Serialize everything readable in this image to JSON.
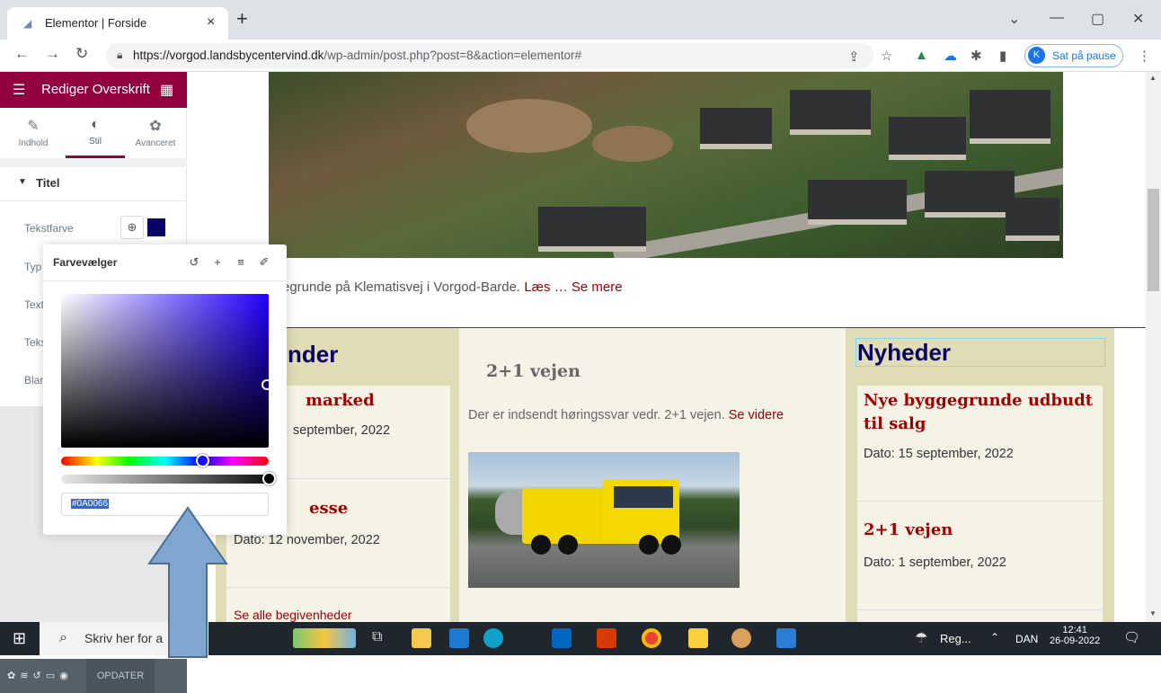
{
  "browser": {
    "tab_title": "Elementor | Forside",
    "tab_close": "×",
    "new_tab": "+",
    "url_host": "https://vorgod.landsbycentervind.dk",
    "url_path": "/wp-admin/post.php?post=8&action=elementor#",
    "profile_initial": "K",
    "profile_label": "Sat på pause",
    "window_controls": [
      "⌄",
      "—",
      "▢",
      "✕"
    ]
  },
  "panel": {
    "header_title": "Rediger Overskrift",
    "tabs": [
      {
        "label": "Indhold",
        "icon": "pencil-icon"
      },
      {
        "label": "Stil",
        "icon": "contrast-icon"
      },
      {
        "label": "Avanceret",
        "icon": "gear-icon"
      }
    ],
    "section_title": "Titel",
    "controls": [
      "Tekstfarve",
      "Typ",
      "Text",
      "Teks",
      "Blan"
    ],
    "footer_update": "OPDATER"
  },
  "color_picker": {
    "title": "Farvevælger",
    "hex_value": "#0A0066",
    "selected_color": "#0a0066"
  },
  "content": {
    "excerpt_text": "egrunde på Klematisvej i Vorgod-Barde.",
    "excerpt_link": "Læs … Se mere",
    "col1_heading": "nder",
    "col1_item1_title": "marked",
    "col1_item1_date": "september, 2022",
    "col1_item2_title": "esse",
    "col1_item2_date": "Dato: 12 november, 2022",
    "col1_link": "Se alle begivenheder",
    "col2_title": "2+1 vejen",
    "col2_text": "Der er  indsendt høringssvar vedr.  2+1 vejen.",
    "col2_link": "Se videre",
    "col3_heading": "Nyheder",
    "col3_item1_title": "Nye byggegrunde udbudt til salg",
    "col3_item1_date": "Dato: 15 september, 2022",
    "col3_item2_title": "2+1 vejen",
    "col3_item2_date": "Dato: 1 september, 2022"
  },
  "taskbar": {
    "search_text": "Skriv her for a",
    "weather_text": "Reg...",
    "lang": "DAN",
    "time": "12:41",
    "date": "26-09-2022"
  },
  "colors": {
    "elementor_brand": "#93003f",
    "heading_navy": "#0a0066",
    "link_red": "#a00000",
    "column_tan": "#e0dcb6",
    "column_cream": "#f5f3e6"
  }
}
